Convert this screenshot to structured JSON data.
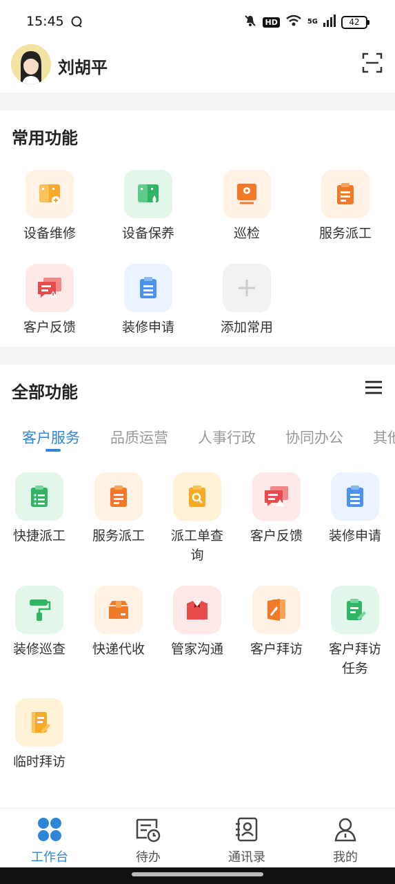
{
  "status": {
    "time": "15:45",
    "network": "5G",
    "hd": "HD",
    "battery": "42"
  },
  "header": {
    "username": "刘胡平"
  },
  "common": {
    "title": "常用功能",
    "items": [
      {
        "label": "设备维修",
        "icon": "device-repair-icon",
        "color": "#f7a928"
      },
      {
        "label": "设备保养",
        "icon": "device-maintenance-icon",
        "color": "#30b565"
      },
      {
        "label": "巡检",
        "icon": "inspection-icon",
        "color": "#f07a2a"
      },
      {
        "label": "服务派工",
        "icon": "service-dispatch-icon",
        "color": "#f07a2a"
      },
      {
        "label": "客户反馈",
        "icon": "customer-feedback-icon",
        "color": "#e84b4b"
      },
      {
        "label": "装修申请",
        "icon": "renovation-apply-icon",
        "color": "#4b93ee"
      },
      {
        "label": "添加常用",
        "icon": "add-icon",
        "color": "#cccccc"
      }
    ]
  },
  "all": {
    "title": "全部功能",
    "tabs": [
      "客户服务",
      "品质运营",
      "人事行政",
      "协同办公",
      "其他"
    ],
    "items": [
      {
        "label1": "快捷派工",
        "label2": "",
        "icon": "quick-dispatch-icon",
        "color": "#30b565"
      },
      {
        "label1": "服务派工",
        "label2": "",
        "icon": "service-dispatch-icon",
        "color": "#f07a2a"
      },
      {
        "label1": "派工单查",
        "label2": "询",
        "icon": "dispatch-query-icon",
        "color": "#f7a928"
      },
      {
        "label1": "客户反馈",
        "label2": "",
        "icon": "customer-feedback-icon",
        "color": "#e84b4b"
      },
      {
        "label1": "装修申请",
        "label2": "",
        "icon": "renovation-apply-icon",
        "color": "#4b93ee"
      },
      {
        "label1": "装修巡查",
        "label2": "",
        "icon": "paint-roller-icon",
        "color": "#30b565"
      },
      {
        "label1": "快递代收",
        "label2": "",
        "icon": "parcel-icon",
        "color": "#f07a2a"
      },
      {
        "label1": "管家沟通",
        "label2": "",
        "icon": "butler-icon",
        "color": "#e84b4b"
      },
      {
        "label1": "客户拜访",
        "label2": "",
        "icon": "visit-icon",
        "color": "#f07a2a"
      },
      {
        "label1": "客户拜访",
        "label2": "任务",
        "icon": "visit-task-icon",
        "color": "#30b565"
      },
      {
        "label1": "临时拜访",
        "label2": "",
        "icon": "temp-visit-icon",
        "color": "#f7a928"
      }
    ]
  },
  "nav": [
    {
      "label": "工作台",
      "icon": "workbench-icon"
    },
    {
      "label": "待办",
      "icon": "todo-icon"
    },
    {
      "label": "通讯录",
      "icon": "contacts-icon"
    },
    {
      "label": "我的",
      "icon": "profile-icon"
    }
  ],
  "colors": {
    "accent": "#2f86d8"
  }
}
